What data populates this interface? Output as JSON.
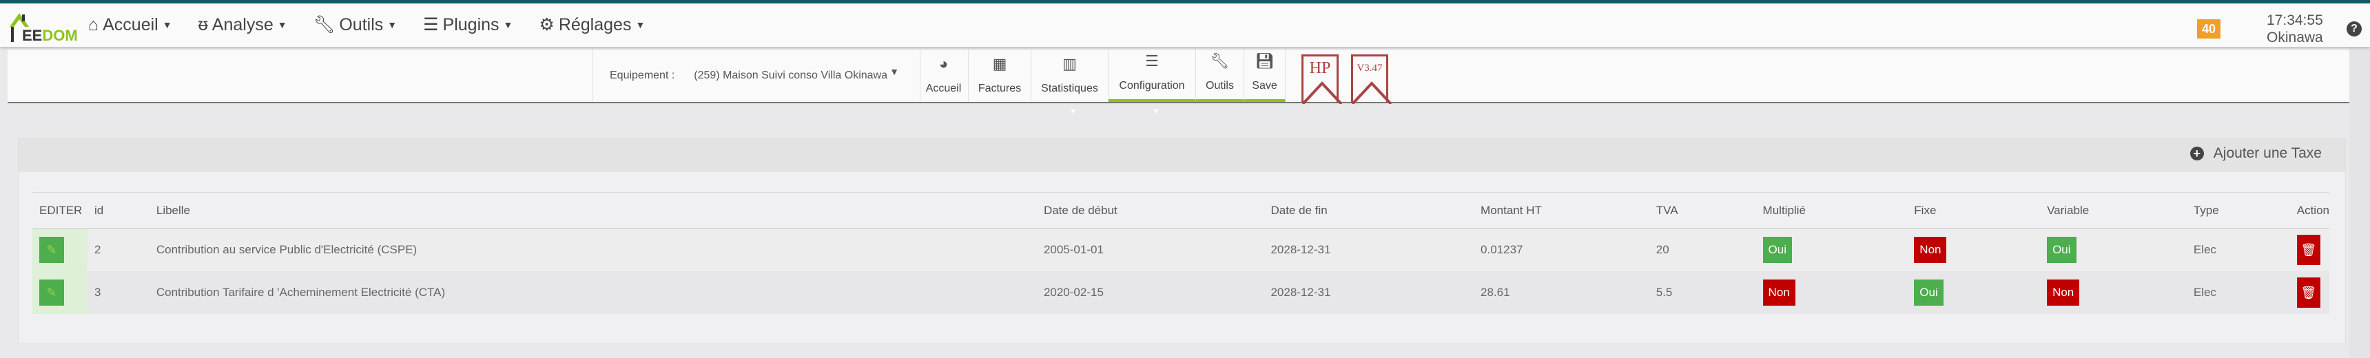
{
  "app": {
    "logo": "JEEDOM"
  },
  "nav": [
    {
      "label": "Accueil",
      "icon": "home-icon"
    },
    {
      "label": "Analyse",
      "icon": "stethoscope-icon"
    },
    {
      "label": "Outils",
      "icon": "wrench-icon"
    },
    {
      "label": "Plugins",
      "icon": "list-icon"
    },
    {
      "label": "Réglages",
      "icon": "gear-icon"
    }
  ],
  "header": {
    "badge": "40",
    "time": "17:34:55",
    "location": "Okinawa"
  },
  "toolbar": {
    "equip_label": "Equipement :",
    "equip_value": "(259) Maison Suivi conso Villa Okinawa",
    "buttons": [
      {
        "label": "Accueil"
      },
      {
        "label": "Factures"
      },
      {
        "label": "Statistiques"
      },
      {
        "label": "Configuration"
      },
      {
        "label": "Outils"
      },
      {
        "label": "Save"
      }
    ],
    "ribbons": [
      "HP",
      "V3.47"
    ]
  },
  "panel": {
    "add_label": "Ajouter une Taxe"
  },
  "table": {
    "headers": [
      "EDITER",
      "id",
      "Libelle",
      "Date de début",
      "Date de fin",
      "Montant HT",
      "TVA",
      "Multiplié",
      "Fixe",
      "Variable",
      "Type",
      "Action"
    ],
    "rows": [
      {
        "id": "2",
        "libelle": "Contribution au service Public d'Electricité (CSPE)",
        "debut": "2005-01-01",
        "fin": "2028-12-31",
        "montant": "0.01237",
        "tva": "20",
        "multiplie": "Oui",
        "fixe": "Non",
        "variable": "Oui",
        "type": "Elec"
      },
      {
        "id": "3",
        "libelle": "Contribution Tarifaire d 'Acheminement Electricité (CTA)",
        "debut": "2020-02-15",
        "fin": "2028-12-31",
        "montant": "28.61",
        "tva": "5.5",
        "multiplie": "Non",
        "fixe": "Oui",
        "variable": "Non",
        "type": "Elec"
      }
    ]
  },
  "colors": {
    "accent": "#8dc21f",
    "teal": "#0d5c63",
    "green": "#4cae4c",
    "red": "#c00000",
    "badge": "#f0a02a"
  }
}
